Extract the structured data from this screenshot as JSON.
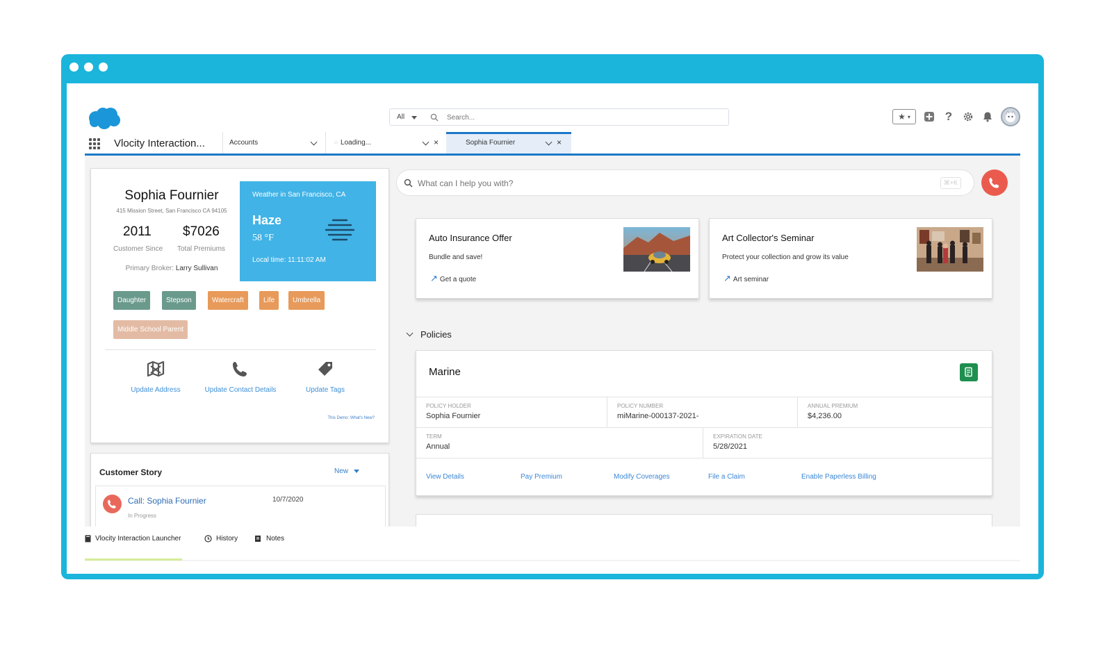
{
  "colors": {
    "frame": "#1bb5dc",
    "brand_blue": "#1b78c8",
    "weather_bg": "#41b3e6",
    "call_red": "#ea5b4e",
    "policy_green": "#1e8f4e"
  },
  "header": {
    "search_scope": "All",
    "search_placeholder": "Search...",
    "icons": [
      "favorites-icon",
      "add-icon",
      "help-icon",
      "setup-gear-icon",
      "notification-bell-icon",
      "user-avatar"
    ]
  },
  "nav": {
    "app_name": "Vlocity Interaction...",
    "tabs": [
      {
        "label": "Accounts"
      },
      {
        "label": "Loading..."
      },
      {
        "label": "Sophia Fournier",
        "selected": true
      }
    ]
  },
  "profile": {
    "name": "Sophia Fournier",
    "address": "415 Mission Street, San Francisco CA 94105",
    "customer_since": "2011",
    "customer_since_label": "Customer Since",
    "total_premiums": "$7026",
    "total_premiums_label": "Total Premiums",
    "broker_label": "Primary Broker:",
    "broker_name": "Larry Sullivan",
    "tags": [
      {
        "label": "Daughter",
        "color": "#6a9a8b"
      },
      {
        "label": "Stepson",
        "color": "#6a9a8b"
      },
      {
        "label": "Watercraft",
        "color": "#e89a5a"
      },
      {
        "label": "Life",
        "color": "#e89a5a"
      },
      {
        "label": "Umbrella",
        "color": "#e89a5a"
      },
      {
        "label": "Middle School Parent",
        "color": "#e3bba4"
      }
    ],
    "actions": [
      {
        "label": "Update Address",
        "icon": "map-icon"
      },
      {
        "label": "Update Contact Details",
        "icon": "phone-icon"
      },
      {
        "label": "Update Tags",
        "icon": "tag-icon"
      }
    ],
    "demo_link": "This Demo: What's New?"
  },
  "weather": {
    "location": "Weather in San Francisco, CA",
    "condition": "Haze",
    "temperature": "58 °F",
    "local_time": "Local time: 11:11:02 AM"
  },
  "customer_story": {
    "title": "Customer Story",
    "new_label": "New",
    "item": {
      "title": "Call: Sophia Fournier",
      "date": "10/7/2020",
      "status": "In Progress"
    }
  },
  "assistant": {
    "placeholder": "What can I help you with?",
    "shortcut": "⌘+K"
  },
  "offers": [
    {
      "title": "Auto Insurance Offer",
      "subtitle": "Bundle and save!",
      "link": "Get a quote"
    },
    {
      "title": "Art Collector's Seminar",
      "subtitle": "Protect your collection and grow its value",
      "link": "Art seminar"
    }
  ],
  "policies": {
    "heading": "Policies",
    "policy": {
      "title": "Marine",
      "policy_holder_label": "Policy Holder",
      "policy_holder": "Sophia Fournier",
      "policy_number_label": "Policy Number",
      "policy_number": "miMarine-000137-2021-",
      "annual_premium_label": "Annual Premium",
      "annual_premium": "$4,236.00",
      "term_label": "Term",
      "term": "Annual",
      "expiration_label": "Expiration Date",
      "expiration": "5/28/2021",
      "links": [
        "View Details",
        "Pay Premium",
        "Modify Coverages",
        "File a Claim",
        "Enable Paperless Billing"
      ]
    }
  },
  "utility_bar": {
    "items": [
      "Vlocity Interaction Launcher",
      "History",
      "Notes"
    ]
  }
}
